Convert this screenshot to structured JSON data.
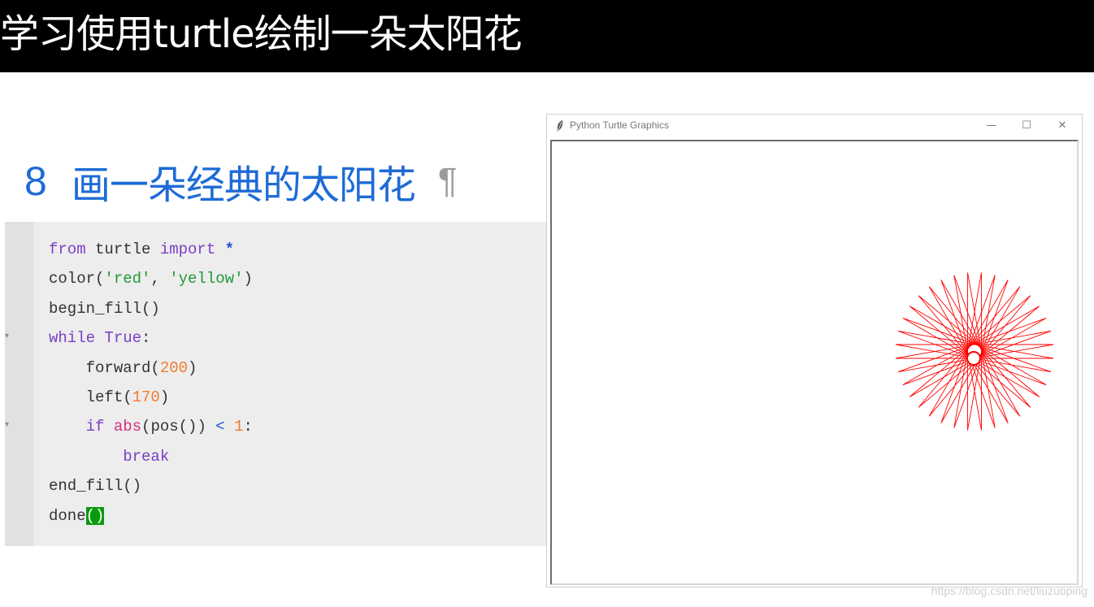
{
  "slide": {
    "title": "学习使用turtle绘制一朵太阳花"
  },
  "section": {
    "number": "8",
    "title": "画一朵经典的太阳花",
    "pilcrow": "¶"
  },
  "code": {
    "lines": [
      {
        "tokens": [
          {
            "t": "from",
            "c": "kw"
          },
          {
            "t": " turtle ",
            "c": ""
          },
          {
            "t": "import",
            "c": "kw"
          },
          {
            "t": " ",
            "c": ""
          },
          {
            "t": "*",
            "c": "kw2"
          }
        ]
      },
      {
        "tokens": [
          {
            "t": "color(",
            "c": ""
          },
          {
            "t": "'red'",
            "c": "str"
          },
          {
            "t": ", ",
            "c": ""
          },
          {
            "t": "'yellow'",
            "c": "str"
          },
          {
            "t": ")",
            "c": ""
          }
        ]
      },
      {
        "tokens": [
          {
            "t": "begin_fill()",
            "c": ""
          }
        ]
      },
      {
        "tokens": [
          {
            "t": "while",
            "c": "kw"
          },
          {
            "t": " ",
            "c": ""
          },
          {
            "t": "True",
            "c": "kw"
          },
          {
            "t": ":",
            "c": ""
          }
        ]
      },
      {
        "tokens": [
          {
            "t": "    forward(",
            "c": ""
          },
          {
            "t": "200",
            "c": "num"
          },
          {
            "t": ")",
            "c": ""
          }
        ]
      },
      {
        "tokens": [
          {
            "t": "    left(",
            "c": ""
          },
          {
            "t": "170",
            "c": "num"
          },
          {
            "t": ")",
            "c": ""
          }
        ]
      },
      {
        "tokens": [
          {
            "t": "    ",
            "c": ""
          },
          {
            "t": "if",
            "c": "kw"
          },
          {
            "t": " ",
            "c": ""
          },
          {
            "t": "abs",
            "c": "fn"
          },
          {
            "t": "(pos()) ",
            "c": ""
          },
          {
            "t": "<",
            "c": "op"
          },
          {
            "t": " ",
            "c": ""
          },
          {
            "t": "1",
            "c": "num"
          },
          {
            "t": ":",
            "c": ""
          }
        ]
      },
      {
        "tokens": [
          {
            "t": "        ",
            "c": ""
          },
          {
            "t": "break",
            "c": "kw"
          }
        ]
      },
      {
        "tokens": [
          {
            "t": "end_fill()",
            "c": ""
          }
        ]
      },
      {
        "tokens": [
          {
            "t": "done",
            "c": ""
          },
          {
            "t": "()",
            "c": "cursor-hl"
          }
        ]
      }
    ]
  },
  "turtle_window": {
    "title": "Python Turtle Graphics",
    "minimize_label": "—",
    "maximize_label": "☐",
    "close_label": "✕",
    "pen_color": "#ff0000",
    "fill_color": "#ffff00",
    "forward": 200,
    "turn": 170
  },
  "watermark": "https://blog.csdn.net/liuzuoping",
  "colors": {
    "banner_bg": "#000000",
    "heading_blue": "#1e6bd6",
    "code_bg": "#ededed"
  }
}
